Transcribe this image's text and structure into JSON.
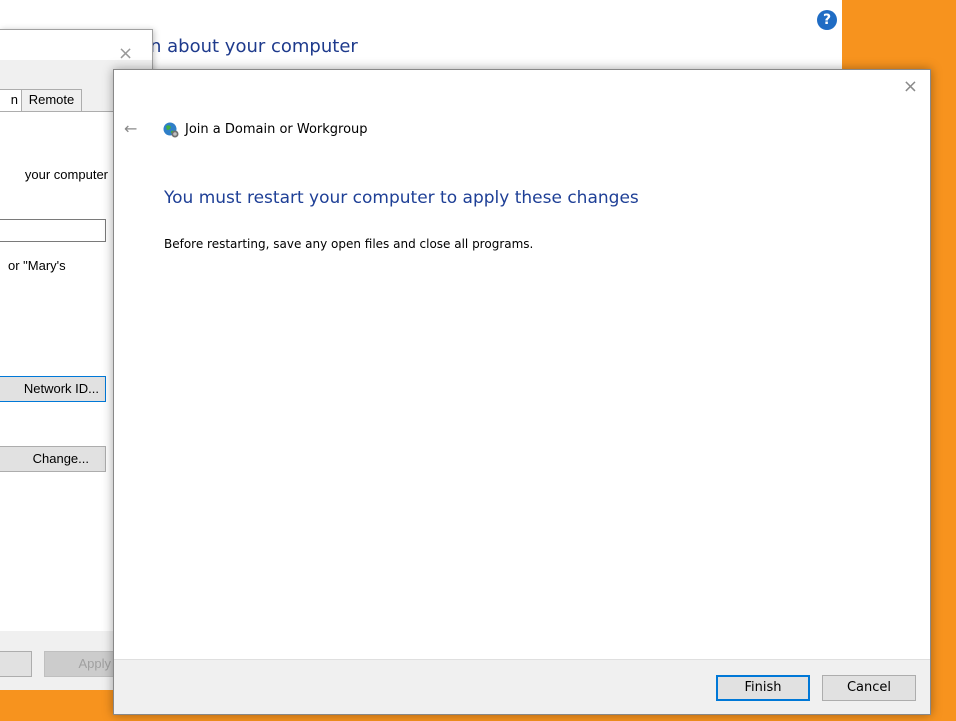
{
  "background_window": {
    "title_partial": "n about your computer",
    "help_icon": "help-icon"
  },
  "system_dialog": {
    "close_glyph": "×",
    "tabs": [
      "n",
      "Remote"
    ],
    "text_line1": "your computer",
    "text_line2": "or \"Mary's",
    "buttons": {
      "network_id": "Network ID...",
      "change": "Change...",
      "apply": "Apply"
    }
  },
  "wizard": {
    "close_glyph": "×",
    "back_glyph": "←",
    "heading": "Join a Domain or Workgroup",
    "main_message": "You must restart your computer to apply these changes",
    "sub_message": "Before restarting, save any open files and close all programs.",
    "buttons": {
      "finish": "Finish",
      "cancel": "Cancel"
    }
  },
  "colors": {
    "accent": "#0078d7",
    "heading_blue": "#1e3f96",
    "desktop_orange": "#f7931e"
  }
}
